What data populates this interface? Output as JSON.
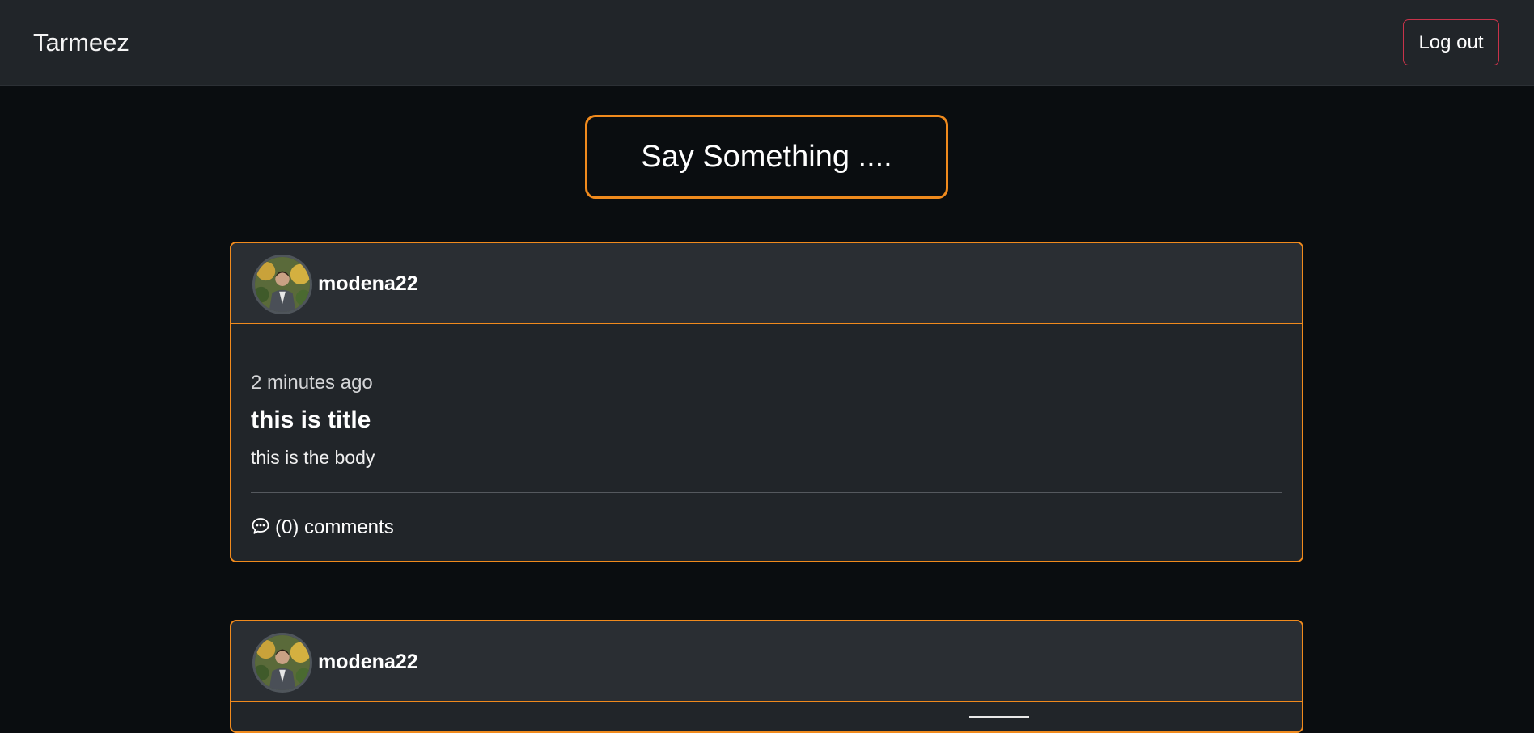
{
  "navbar": {
    "brand": "Tarmeez",
    "logout_label": "Log out"
  },
  "composer": {
    "label": "Say Something ...."
  },
  "posts": [
    {
      "username": "modena22",
      "time": "2 minutes ago",
      "title": "this is title",
      "body": "this is the body",
      "comments_label": "(0) comments"
    },
    {
      "username": "modena22"
    }
  ],
  "colors": {
    "background": "#0a0d10",
    "navbar": "#212529",
    "card": "#212529",
    "accent_orange": "#f08a1d",
    "logout_border": "#c8334a"
  },
  "icons": {
    "comment": "chat-bubble-dots-icon"
  }
}
